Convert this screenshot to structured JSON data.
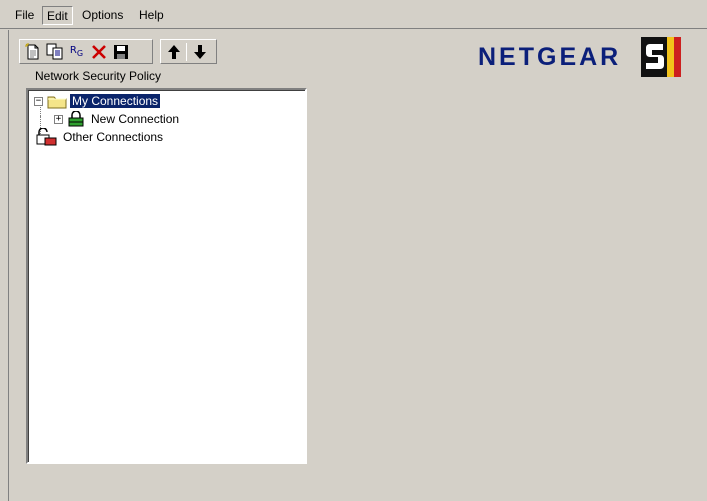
{
  "menu": {
    "file": "File",
    "edit": "Edit",
    "options": "Options",
    "help": "Help"
  },
  "toolbar": {
    "buttons": [
      {
        "icon": "new-document-icon"
      },
      {
        "icon": "copy-icon"
      },
      {
        "icon": "rename-icon",
        "glyph": "RG"
      },
      {
        "icon": "delete-icon",
        "glyph": "✕"
      },
      {
        "icon": "save-icon"
      },
      {
        "icon": "move-up-icon",
        "glyph": "🡑"
      },
      {
        "icon": "move-down-icon",
        "glyph": "🡓"
      }
    ]
  },
  "logo": {
    "text": "NETGEAR",
    "colors": {
      "text": "#0b1f7a",
      "mark_red": "#cc1f1f",
      "mark_yellow": "#f2c21a"
    }
  },
  "panel": {
    "title": "Network Security Policy"
  },
  "tree": {
    "items": [
      {
        "label": "My Connections",
        "icon": "folder-icon",
        "expander": "−",
        "selected": true
      },
      {
        "label": "New Connection",
        "icon": "secure-connection-icon",
        "expander": "+"
      },
      {
        "label": "Other Connections",
        "icon": "unsecure-connection-icon"
      }
    ]
  },
  "colors": {
    "window_bg": "#d4d0c8",
    "selection_bg": "#0a246a",
    "selection_fg": "#ffffff"
  }
}
